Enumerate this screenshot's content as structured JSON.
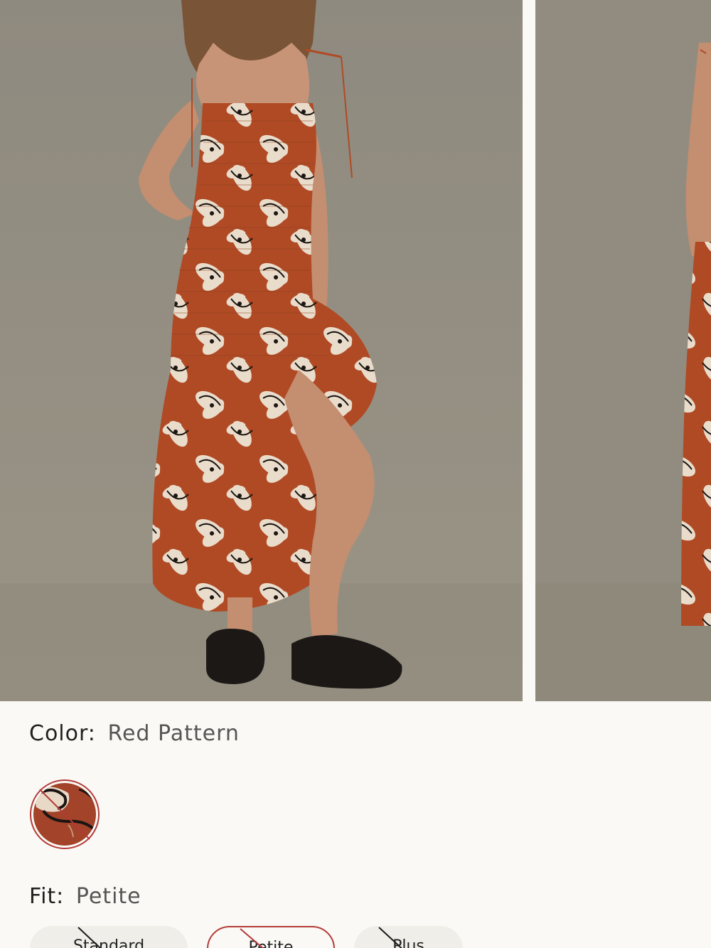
{
  "product_images": [
    {
      "icon": "product-photo-front"
    },
    {
      "icon": "product-photo-side"
    }
  ],
  "color": {
    "label": "Color:",
    "value": "Red Pattern",
    "swatch_icon": "red-pattern-swatch",
    "swatch_available": false,
    "accent": "#b43a38"
  },
  "fit": {
    "label": "Fit:",
    "value": "Petite",
    "options": [
      {
        "label": "Standard",
        "available": false,
        "selected": false
      },
      {
        "label": "Petite",
        "available": false,
        "selected": true
      },
      {
        "label": "Plus",
        "available": false,
        "selected": false
      }
    ]
  }
}
